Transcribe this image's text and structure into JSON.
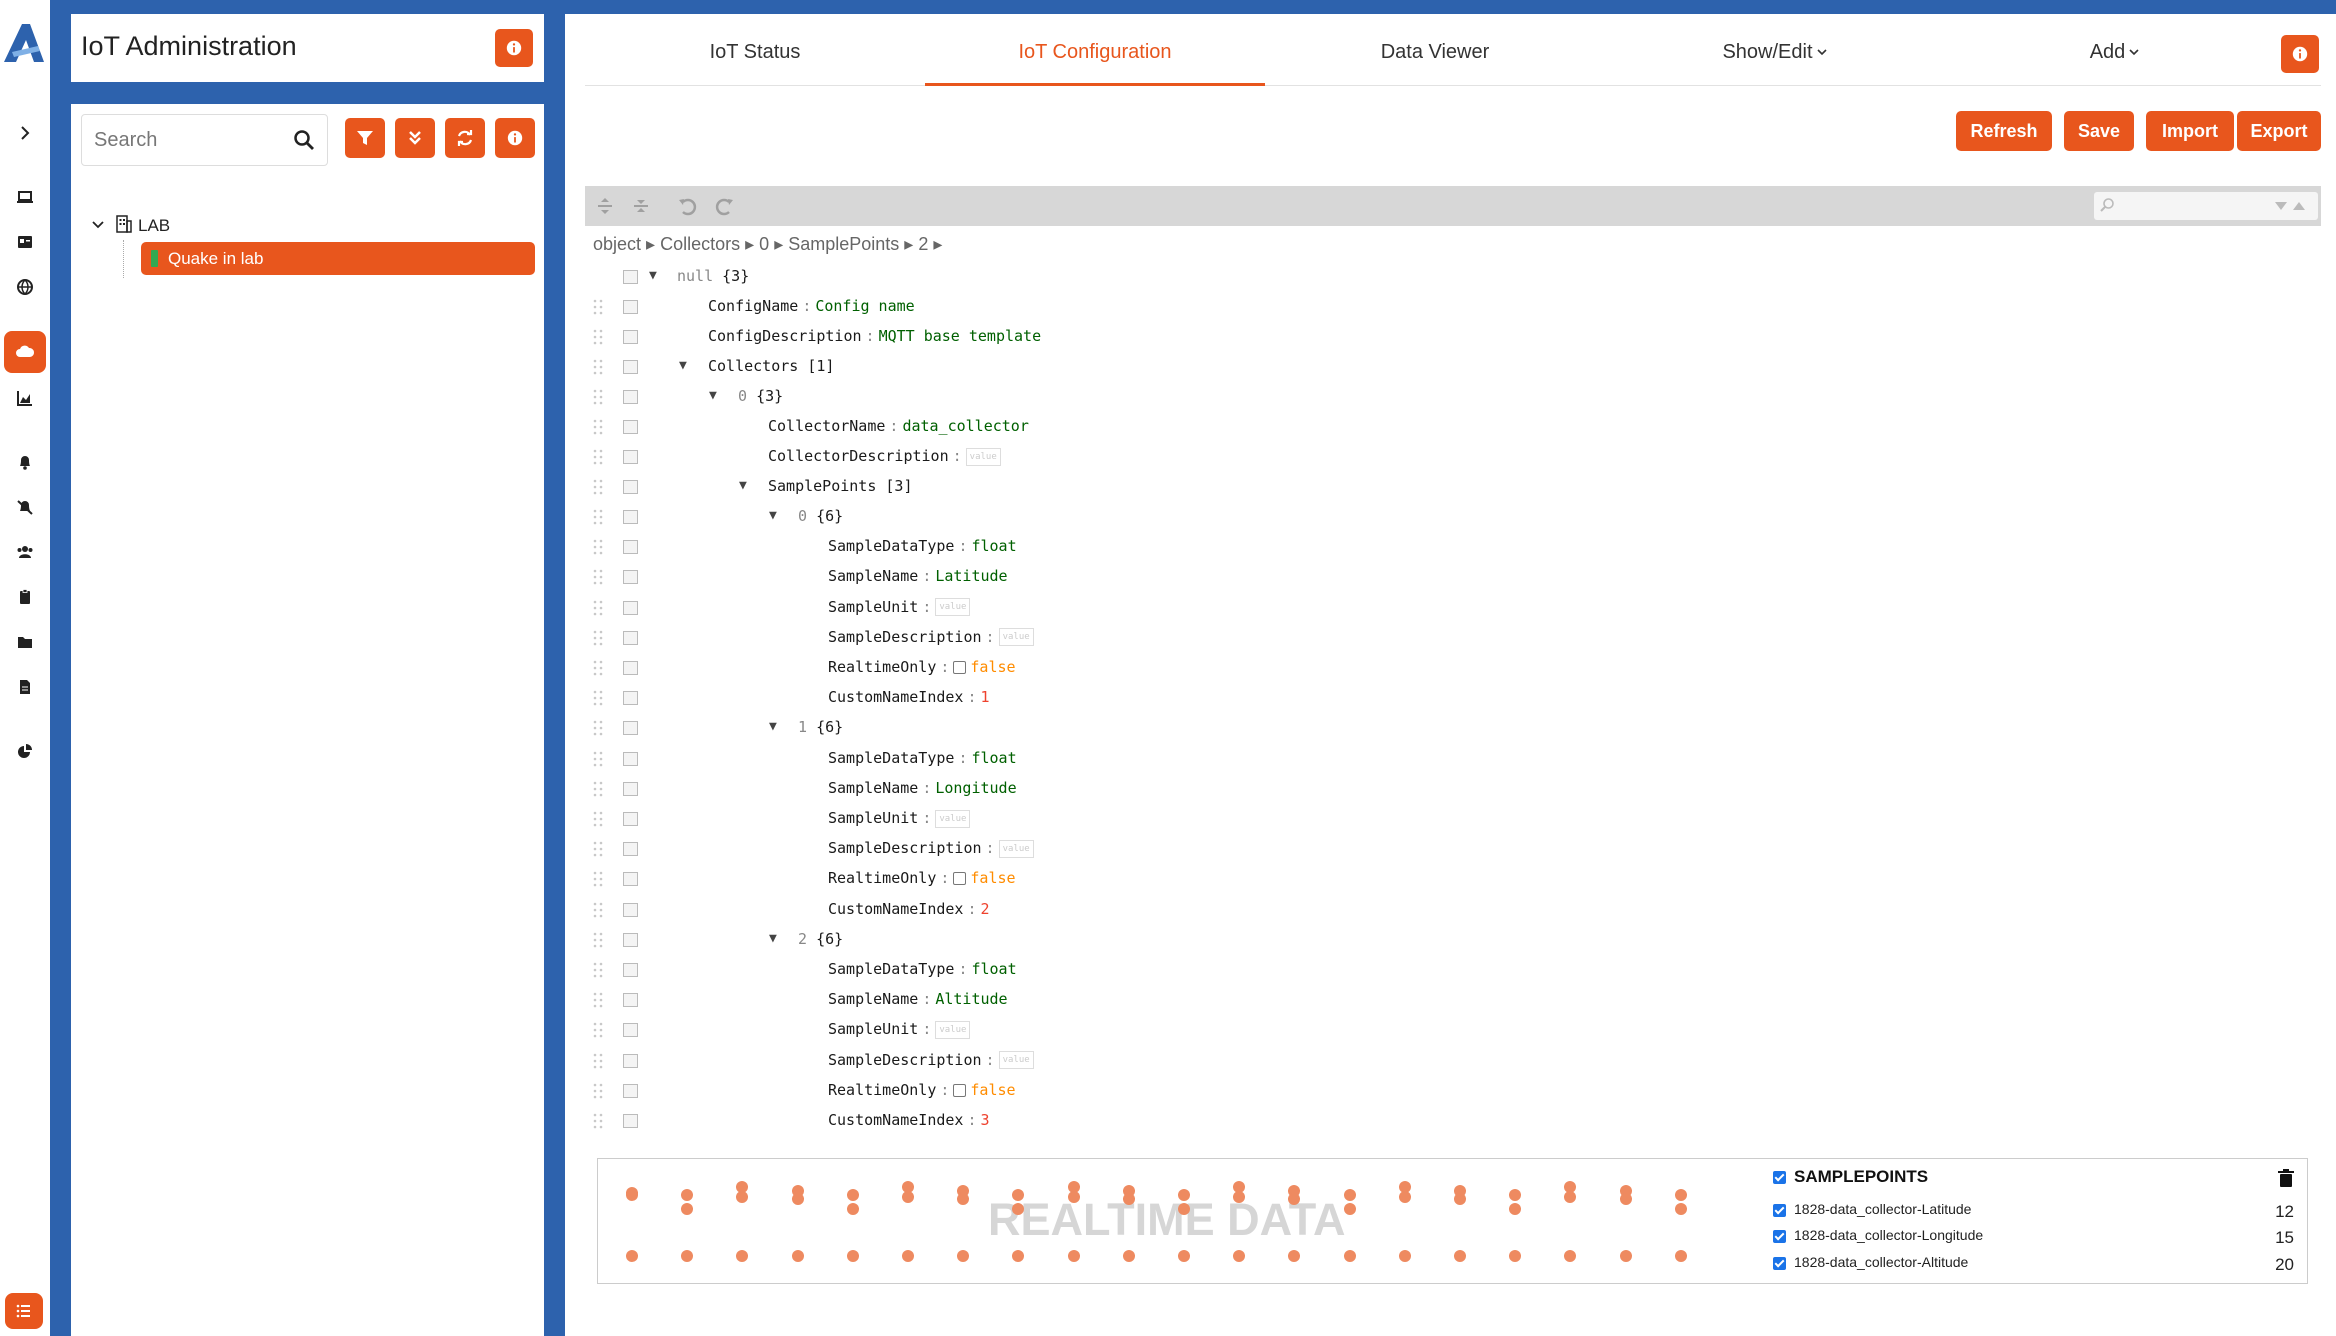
{
  "app": {
    "title": "IoT Administration"
  },
  "search": {
    "placeholder": "Search"
  },
  "tree": {
    "root": "LAB",
    "child": "Quake in lab"
  },
  "tabs": [
    "IoT Status",
    "IoT Configuration",
    "Data Viewer",
    "Show/Edit",
    "Add"
  ],
  "actions": [
    "Refresh",
    "Save",
    "Import",
    "Export"
  ],
  "breadcrumb": [
    "object",
    "Collectors",
    "0",
    "SamplePoints",
    "2"
  ],
  "editor": {
    "null_label": "null",
    "null_count": "{3}",
    "config_name_key": "ConfigName",
    "config_name_val": "Config name",
    "config_desc_key": "ConfigDescription",
    "config_desc_val": "MQTT base template",
    "collectors_key": "Collectors",
    "collectors_count": "[1]",
    "c0_idx": "0",
    "c0_count": "{3}",
    "collector_name_key": "CollectorName",
    "collector_name_val": "data_collector",
    "collector_desc_key": "CollectorDescription",
    "empty_val": "value",
    "samplepoints_key": "SamplePoints",
    "samplepoints_count": "[3]",
    "sp_count": "{6}",
    "k_type": "SampleDataType",
    "k_name": "SampleName",
    "k_unit": "SampleUnit",
    "k_desc": "SampleDescription",
    "k_rt": "RealtimeOnly",
    "k_idx": "CustomNameIndex",
    "sp": [
      {
        "idx": "0",
        "type": "float",
        "name": "Latitude",
        "rt": "false",
        "cni": "1"
      },
      {
        "idx": "1",
        "type": "float",
        "name": "Longitude",
        "rt": "false",
        "cni": "2"
      },
      {
        "idx": "2",
        "type": "float",
        "name": "Altitude",
        "rt": "false",
        "cni": "3"
      }
    ]
  },
  "realtime": {
    "title": "REALTIME DATA",
    "legend_head": "SAMPLEPOINTS",
    "items": [
      {
        "label": "1828-data_collector-Latitude",
        "count": "12"
      },
      {
        "label": "1828-data_collector-Longitude",
        "count": "15"
      },
      {
        "label": "1828-data_collector-Altitude",
        "count": "20"
      }
    ]
  },
  "colors": {
    "accent": "#e8561d",
    "frame": "#2d62ad"
  }
}
